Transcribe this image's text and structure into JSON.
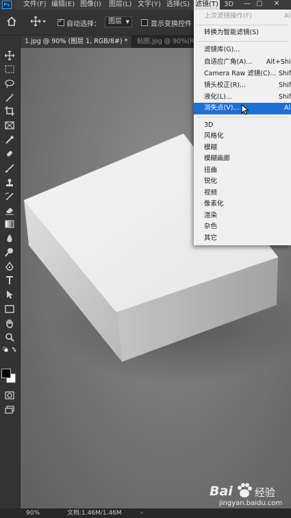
{
  "app": {
    "logo": "Ps"
  },
  "menubar": {
    "items": [
      "文件(F)",
      "编辑(E)",
      "图像(I)",
      "图层(L)",
      "文字(Y)",
      "选择(S)",
      "滤镜(T)",
      "3D"
    ],
    "active": "滤镜(T)"
  },
  "window_controls": {
    "minimize": "—",
    "restore": "□",
    "close": "✕"
  },
  "options": {
    "auto_select_label": "自动选择：",
    "layer_select_value": "图层",
    "show_transform_label": "显示变换控件"
  },
  "tabs": [
    "1.jpg @ 90% (图层 1, RGB/8#) *",
    "贴图.jpg @ 90%(R"
  ],
  "status": {
    "zoom": "90%",
    "doc_info": "文档:1.46M/1.46M",
    "arrow": "›"
  },
  "filter_menu": {
    "top_items": [
      {
        "label": "上次滤镜操作(F)",
        "shortcut": "Al",
        "disabled": true
      },
      {
        "label": "转换为智能滤镜(S)",
        "shortcut": ""
      }
    ],
    "middle_items": [
      {
        "label": "滤镜库(G)...",
        "shortcut": ""
      },
      {
        "label": "自适应广角(A)...",
        "shortcut": "Alt+Shif"
      },
      {
        "label": "Camera Raw 滤镜(C)...",
        "shortcut": "Shif"
      },
      {
        "label": "镜头校正(R)...",
        "shortcut": "Shif"
      },
      {
        "label": "液化(L)...",
        "shortcut": "Shif"
      },
      {
        "label": "消失点(V)...",
        "shortcut": "Al",
        "highlighted": true
      }
    ],
    "submenus": [
      "3D",
      "风格化",
      "模糊",
      "模糊画廊",
      "扭曲",
      "锐化",
      "视频",
      "像素化",
      "渲染",
      "杂色",
      "其它"
    ]
  },
  "watermark": {
    "brand": "Bai",
    "brand_cn": "经验",
    "url": "jingyan.baidu.com"
  },
  "colors": {
    "accent_highlight": "#1e6fd6",
    "menu_bg": "#f0f0f0",
    "ui_dark": "#333333",
    "ps_blue": "#31a8ff"
  }
}
